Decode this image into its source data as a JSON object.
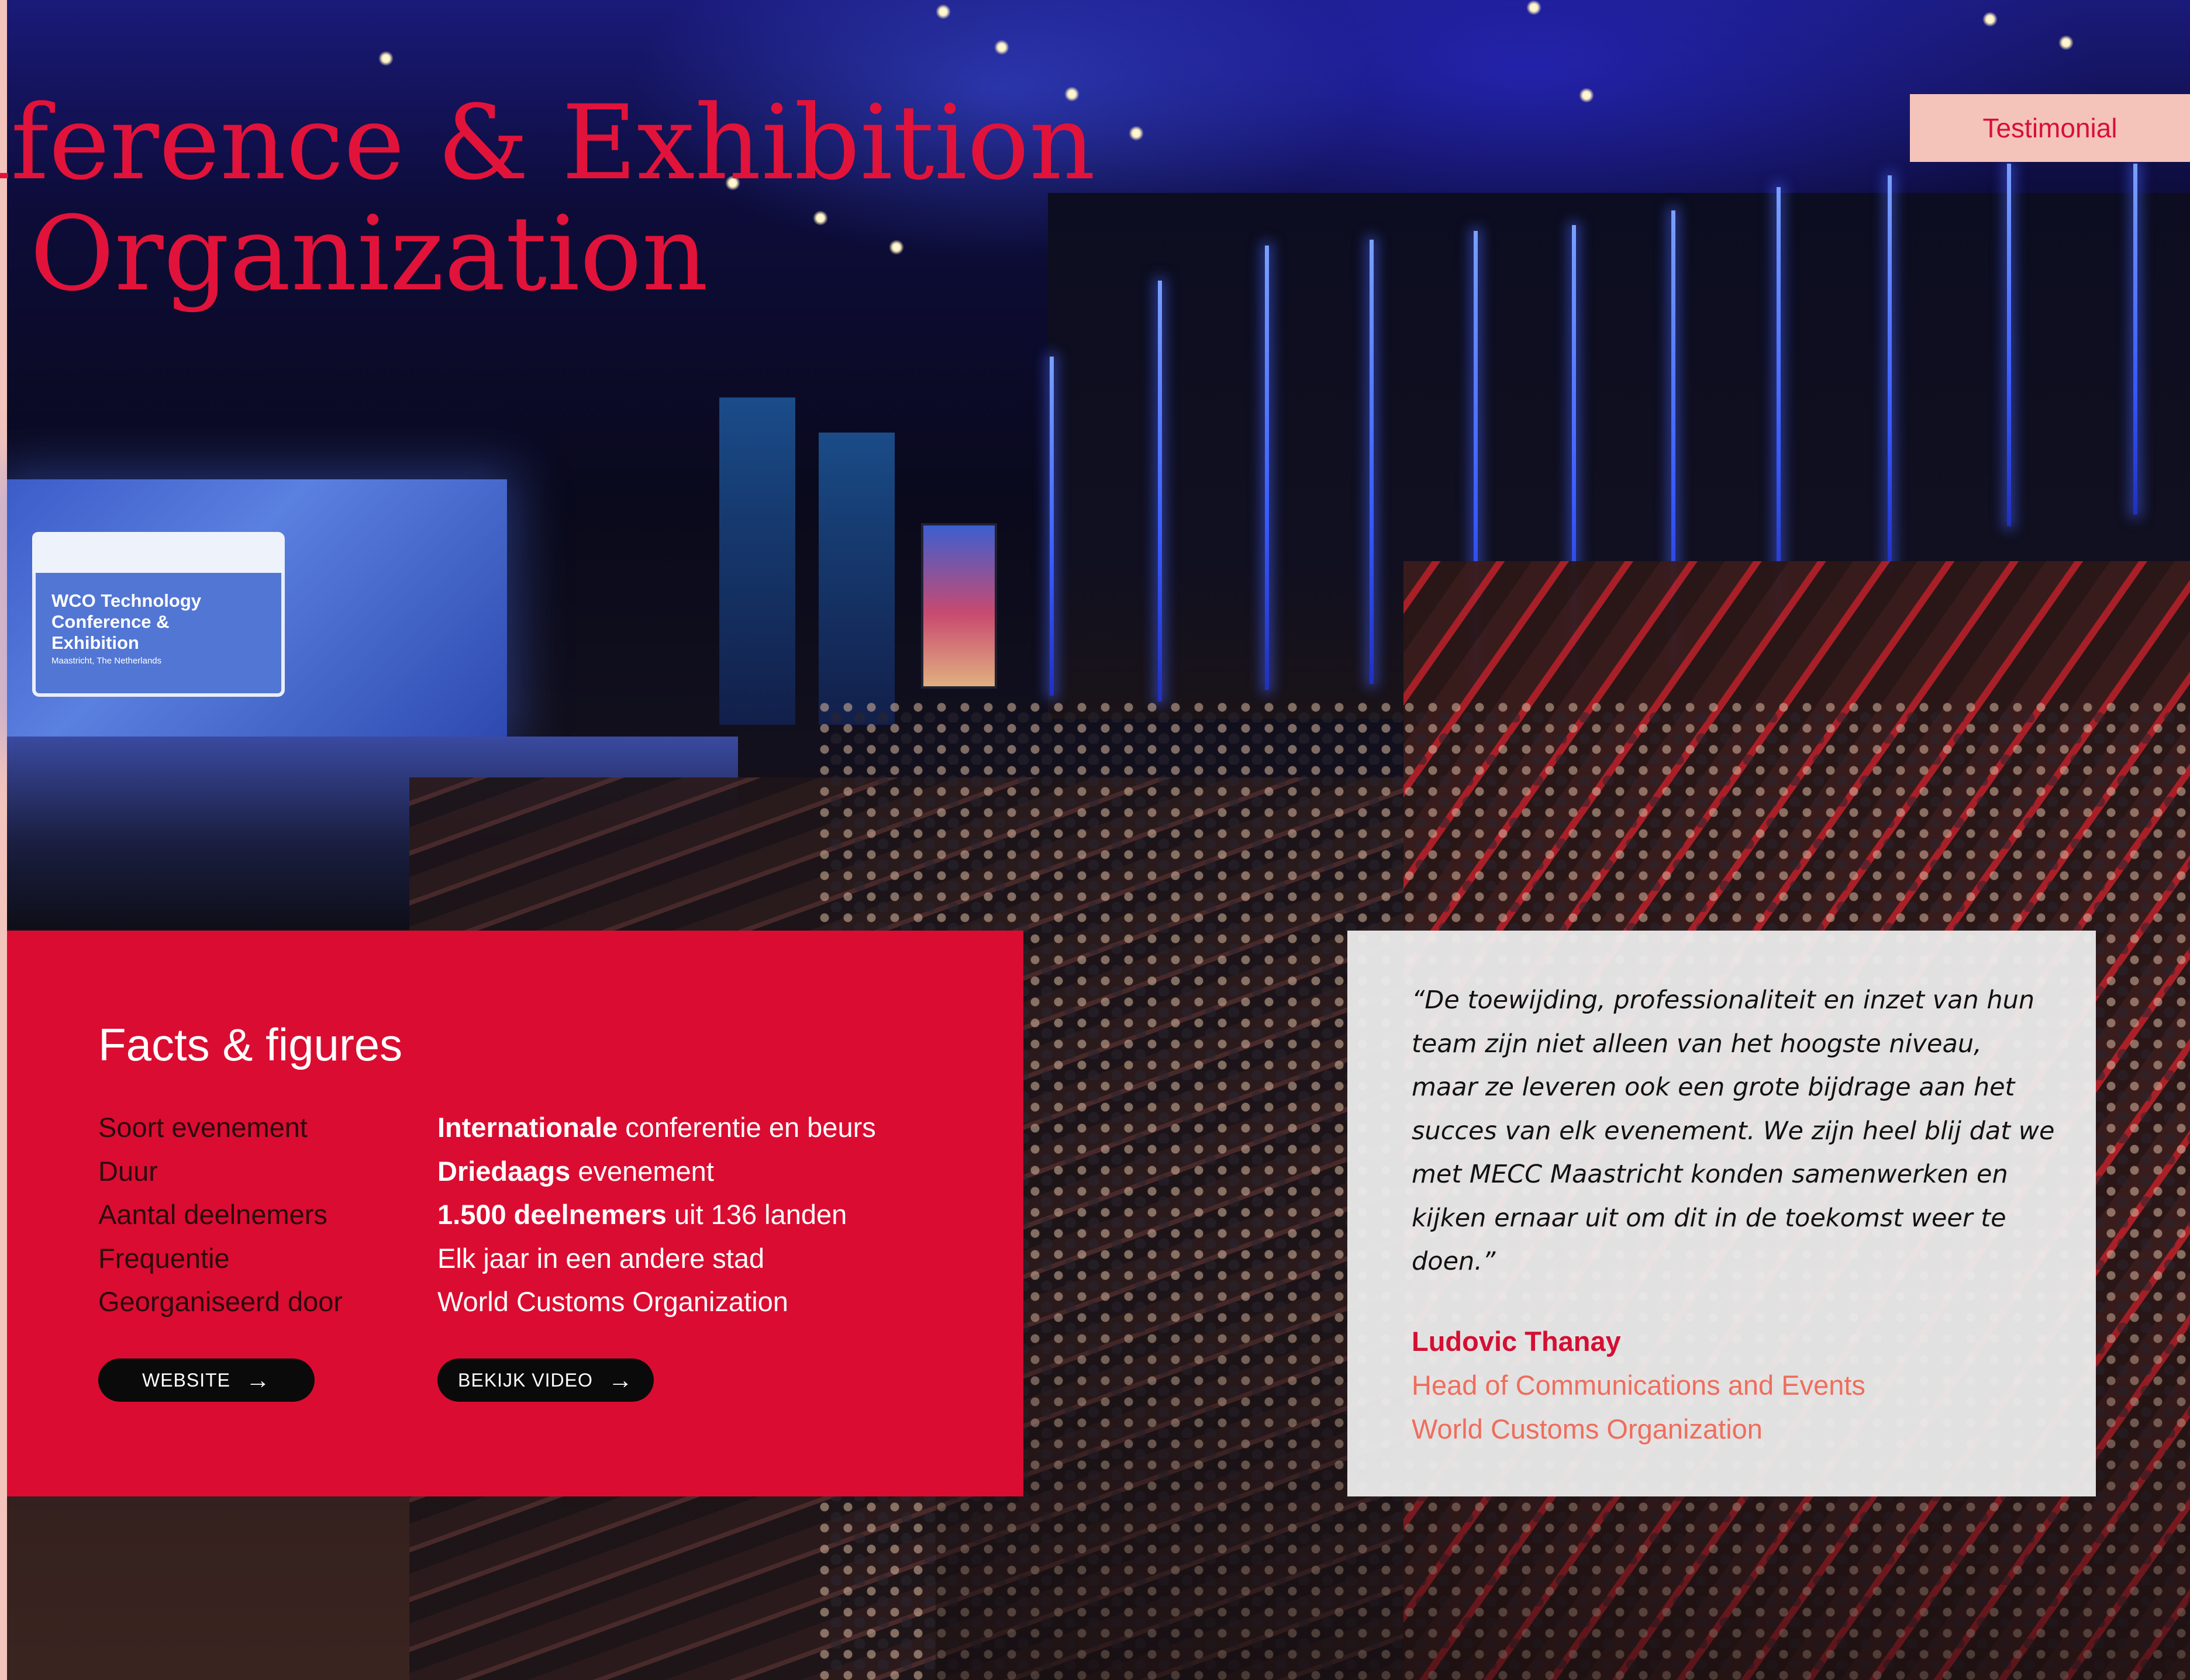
{
  "hero": {
    "title_line1": "nference & Exhibition",
    "title_line2": "s Organization",
    "photo_screen_title": "WCO Technology Conference & Exhibition",
    "photo_screen_subtitle": "Maastricht, The Netherlands"
  },
  "tab": {
    "label": "Testimonial"
  },
  "facts": {
    "title": "Facts & figures",
    "rows": [
      {
        "label": "Soort evenement",
        "value_bold": "Internationale",
        "value_rest": " conferentie en beurs"
      },
      {
        "label": "Duur",
        "value_bold": "Driedaags",
        "value_rest": " evenement"
      },
      {
        "label": "Aantal deelnemers",
        "value_bold": "1.500 deelnemers",
        "value_rest": " uit 136 landen"
      },
      {
        "label": "Frequentie",
        "value_bold": "",
        "value_rest": "Elk jaar in een andere stad"
      },
      {
        "label": "Georganiseerd door",
        "value_bold": "",
        "value_rest": "World Customs Organization"
      }
    ],
    "website_button": "WEBSITE",
    "video_button": "BEKIJK VIDEO"
  },
  "quote": {
    "text": "“De toewijding, professionaliteit en inzet van hun team zijn niet alleen van het hoogste niveau, maar ze leveren ook een grote bijdrage aan het succes van elk evenement. We zijn heel blij dat we met MECC Maastricht konden samenwerken en kijken ernaar uit om dit in de toekomst weer te doen.”",
    "author": "Ludovic Thanay",
    "role": "Head of Communications and Events",
    "organization": "World Customs Organization"
  },
  "icons": {
    "arrow": "arrow-right-icon"
  },
  "colors": {
    "brand_red": "#db0c31",
    "tab_pink": "#f4c3ba",
    "role_salmon": "#ef6d5c"
  }
}
